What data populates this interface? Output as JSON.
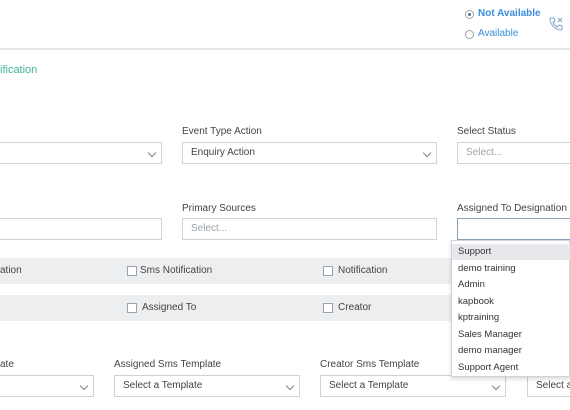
{
  "header": {
    "status_options": [
      {
        "label": "Not Available",
        "selected": true,
        "color": "#3b8fd9"
      },
      {
        "label": "Available",
        "selected": false,
        "color": "#3b8fd9"
      }
    ],
    "phone_icon": "phone-icon"
  },
  "section": {
    "title": "ification"
  },
  "row1": {
    "left_select_value": "",
    "event_type_action_label": "Event Type Action",
    "event_type_action_value": "Enquiry Action",
    "select_status_label": "Select Status",
    "select_status_placeholder": "Select..."
  },
  "row2": {
    "primary_sources_label": "Primary Sources",
    "primary_sources_placeholder": "Select...",
    "assigned_designation_label": "Assigned To Designation"
  },
  "notification_bar": {
    "left_label": "ation",
    "sms_notification_label": "Sms Notification",
    "notification_label": "Notification"
  },
  "assign_bar": {
    "assigned_to_label": "Assigned To",
    "creator_label": "Creator"
  },
  "templates": {
    "left_label": "ate",
    "assigned_sms_label": "Assigned Sms Template",
    "assigned_sms_value": "Select a Template",
    "creator_sms_label": "Creator Sms Template",
    "creator_sms_value": "Select a Template",
    "right_value": "Select a"
  },
  "designation_dropdown": {
    "items": [
      "Support",
      "demo training",
      "Admin",
      "kapbook",
      "kptraining",
      "Sales Manager",
      "demo manager",
      "Support Agent"
    ],
    "highlighted": "Support"
  },
  "colors": {
    "accent": "#3fb49a",
    "link": "#3b8fd9",
    "bar_bg": "#eceef0",
    "border": "#ced3d9"
  }
}
